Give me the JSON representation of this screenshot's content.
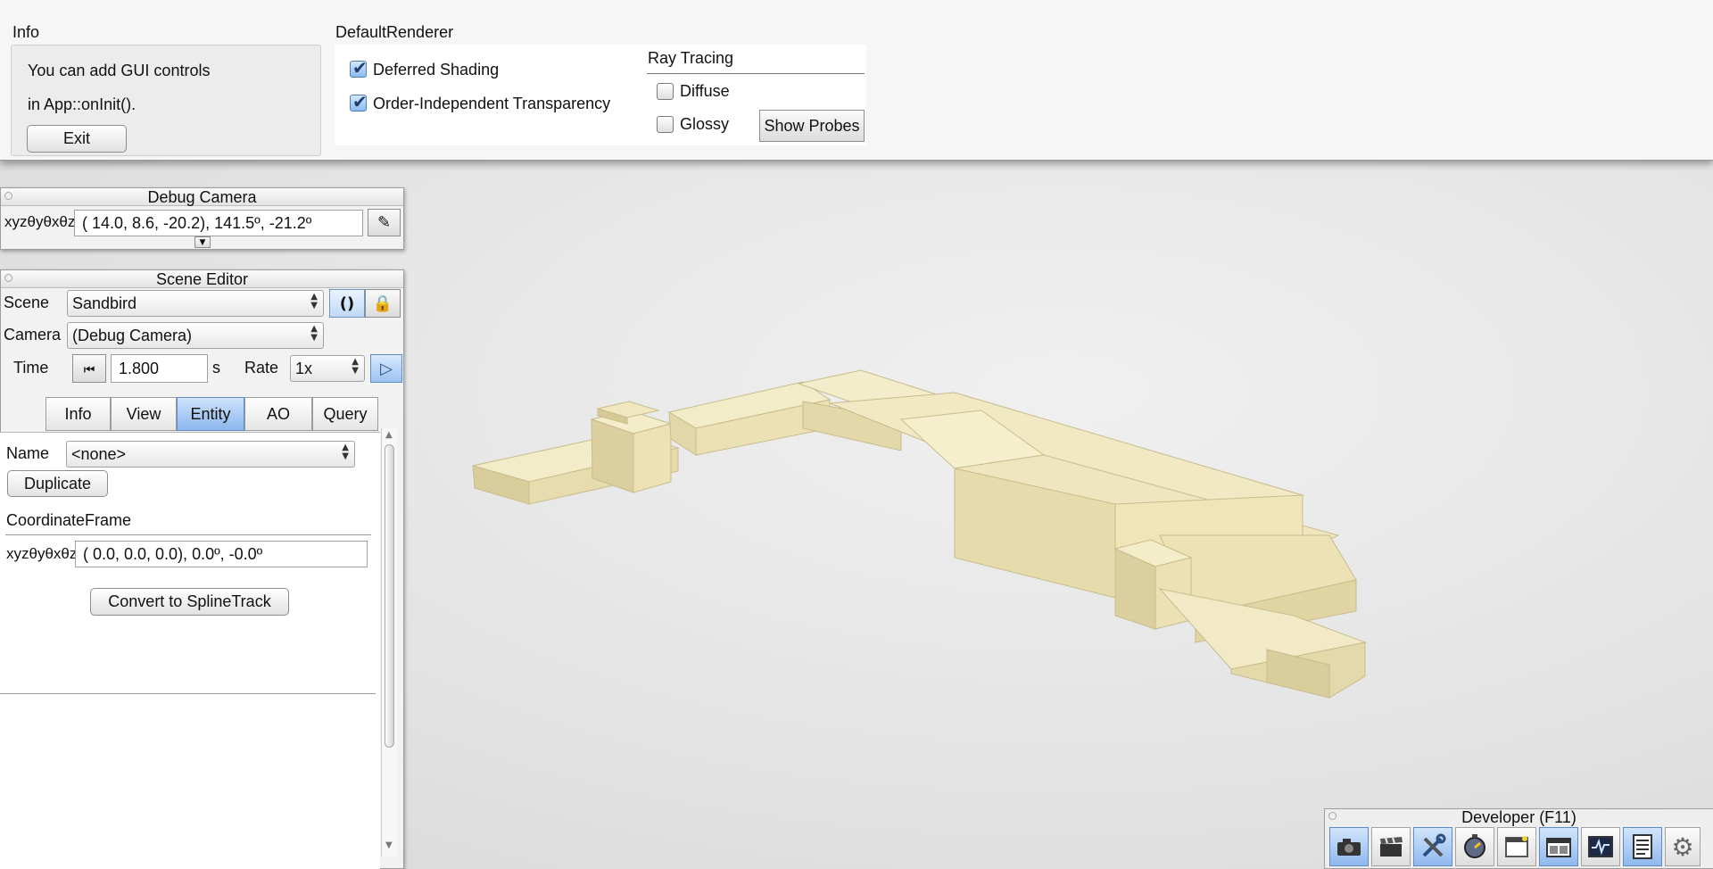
{
  "info": {
    "title": "Info",
    "line1": "You can add GUI controls",
    "line2": "in App::onInit().",
    "exit_label": "Exit"
  },
  "renderer": {
    "title": "DefaultRenderer",
    "deferred_shading": {
      "label": "Deferred Shading",
      "checked": true
    },
    "oit": {
      "label": "Order-Independent Transparency",
      "checked": true
    },
    "ray_tracing": {
      "title": "Ray Tracing",
      "diffuse": {
        "label": "Diffuse",
        "checked": false
      },
      "glossy": {
        "label": "Glossy",
        "checked": false
      },
      "show_probes_label": "Show Probes"
    }
  },
  "debug_camera": {
    "title": "Debug Camera",
    "frame_label": "xyzθyθxθz",
    "frame_value": "( 14.0,   8.6, -20.2),  141.5º, -21.2º"
  },
  "scene_editor": {
    "title": "Scene Editor",
    "scene_label": "Scene",
    "scene_value": "Sandbird",
    "camera_label": "Camera",
    "camera_value": "(Debug Camera)",
    "time_label": "Time",
    "time_value": "1.800",
    "time_unit": "s",
    "rate_label": "Rate",
    "rate_value": "1x",
    "tabs": [
      {
        "label": "Info",
        "active": false
      },
      {
        "label": "View",
        "active": false
      },
      {
        "label": "Entity",
        "active": true
      },
      {
        "label": "AO",
        "active": false
      },
      {
        "label": "Query",
        "active": false
      }
    ],
    "entity": {
      "name_label": "Name",
      "name_value": "<none>",
      "duplicate_label": "Duplicate",
      "cframe_title": "CoordinateFrame",
      "frame_label": "xyzθyθxθz",
      "frame_value": "(  0.0,   0.0,   0.0),   0.0º,  -0.0º",
      "convert_label": "Convert to SplineTrack"
    }
  },
  "developer": {
    "title": "Developer (F11)",
    "buttons": [
      {
        "icon": "camera-icon",
        "active": true
      },
      {
        "icon": "clapperboard-icon",
        "active": false
      },
      {
        "icon": "tools-icon",
        "active": true
      },
      {
        "icon": "stopwatch-icon",
        "active": false
      },
      {
        "icon": "window-icon",
        "active": false
      },
      {
        "icon": "scene-editor-icon",
        "active": true
      },
      {
        "icon": "profiler-icon",
        "active": false
      },
      {
        "icon": "console-icon",
        "active": true
      },
      {
        "icon": "settings-gear-icon",
        "active": false
      }
    ]
  },
  "colors": {
    "accent": "#8bb6ee",
    "block": "#e6dbae"
  }
}
